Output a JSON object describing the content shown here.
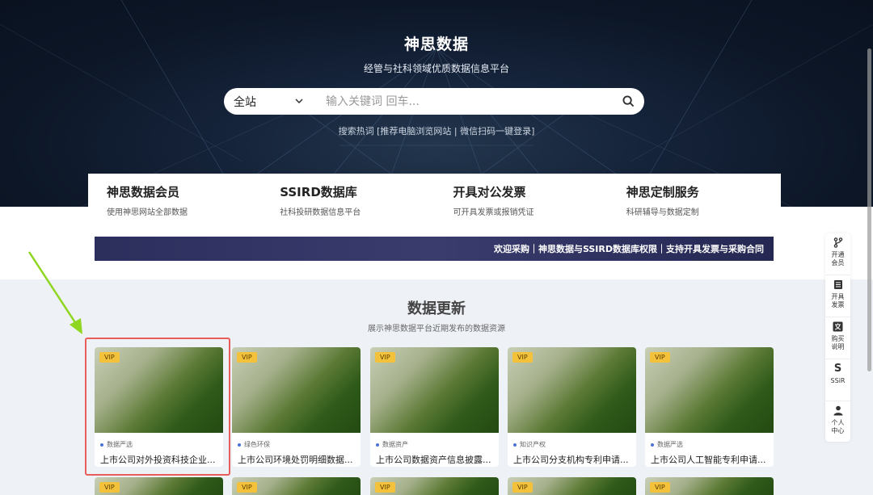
{
  "hero": {
    "title": "神思数据",
    "subtitle": "经管与社科领域优质数据信息平台",
    "search": {
      "scope": "全站",
      "placeholder": "输入关键词 回车..."
    },
    "hot_text": "搜索热词 [推荐电脑浏览网站 | 微信扫码一键登录]"
  },
  "features": [
    {
      "title": "神思数据会员",
      "desc": "使用神思网站全部数据"
    },
    {
      "title": "SSIRD数据库",
      "desc": "社科投研数据信息平台"
    },
    {
      "title": "开具对公发票",
      "desc": "可开具发票或报销凭证"
    },
    {
      "title": "神思定制服务",
      "desc": "科研辅导与数据定制"
    }
  ],
  "notice": "欢迎采购｜神思数据与SSIRD数据库权限｜支持开具发票与采购合同",
  "section": {
    "title": "数据更新",
    "subtitle": "展示神思数据平台近期发布的数据资源"
  },
  "cards": [
    {
      "badge": "VIP",
      "category": "数据严选",
      "title": "上市公司对外投资科技企业..."
    },
    {
      "badge": "VIP",
      "category": "绿色环保",
      "title": "上市公司环境处罚明细数据..."
    },
    {
      "badge": "VIP",
      "category": "数据资产",
      "title": "上市公司数据资产信息披露..."
    },
    {
      "badge": "VIP",
      "category": "知识产权",
      "title": "上市公司分支机构专利申请..."
    },
    {
      "badge": "VIP",
      "category": "数据严选",
      "title": "上市公司人工智能专利申请..."
    }
  ],
  "cards_row2": [
    {
      "badge": "VIP"
    },
    {
      "badge": "VIP"
    },
    {
      "badge": "VIP"
    },
    {
      "badge": "VIP"
    },
    {
      "badge": "VIP"
    }
  ],
  "sidebar": [
    {
      "icon": "branch-icon",
      "label": "开通会员"
    },
    {
      "icon": "invoice-icon",
      "label": "开具发票"
    },
    {
      "icon": "translate-icon",
      "label": "购买说明"
    },
    {
      "icon": "s-logo-icon",
      "label": "SSiR"
    },
    {
      "icon": "user-icon",
      "label": "个人中心"
    }
  ],
  "colors": {
    "highlight": "#e85c5c",
    "arrow": "#8ed620",
    "vip": "#f3c23a",
    "notice_bg": "#2c2e5c"
  }
}
